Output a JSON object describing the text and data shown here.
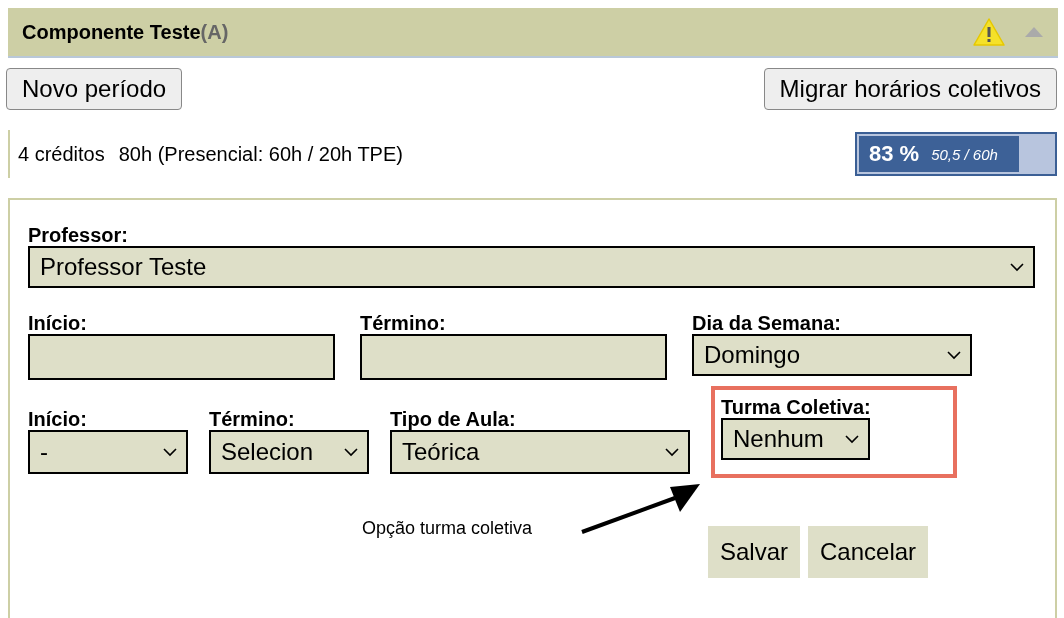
{
  "header": {
    "title": "Componente Teste",
    "suffix": "(A)"
  },
  "buttons": {
    "left": "Novo período",
    "right": "Migrar horários coletivos"
  },
  "info": {
    "credits": "4 créditos",
    "hours": "80h (Presencial: 60h / 20h TPE)"
  },
  "progress": {
    "percent": "83 %",
    "reading": "50,5 / 60h",
    "level": 0.81
  },
  "form": {
    "professor": {
      "label": "Professor:",
      "value": "Professor Teste"
    },
    "row2": [
      {
        "kind": "text",
        "label": "Início:"
      },
      {
        "kind": "text",
        "label": "Término:"
      },
      {
        "kind": "select",
        "label": "Dia da Semana:",
        "value": "Domingo"
      }
    ],
    "row3": [
      {
        "label": "Início:",
        "value": "-"
      },
      {
        "label": "Término:",
        "value": "Selecion"
      },
      {
        "label": "Tipo de Aula:",
        "value": "Teórica"
      }
    ],
    "collective": {
      "label": "Turma Coletiva:",
      "value": "Nenhum"
    },
    "annotation": "Opção turma coletiva",
    "actions": [
      "Salvar",
      "Cancelar"
    ]
  }
}
